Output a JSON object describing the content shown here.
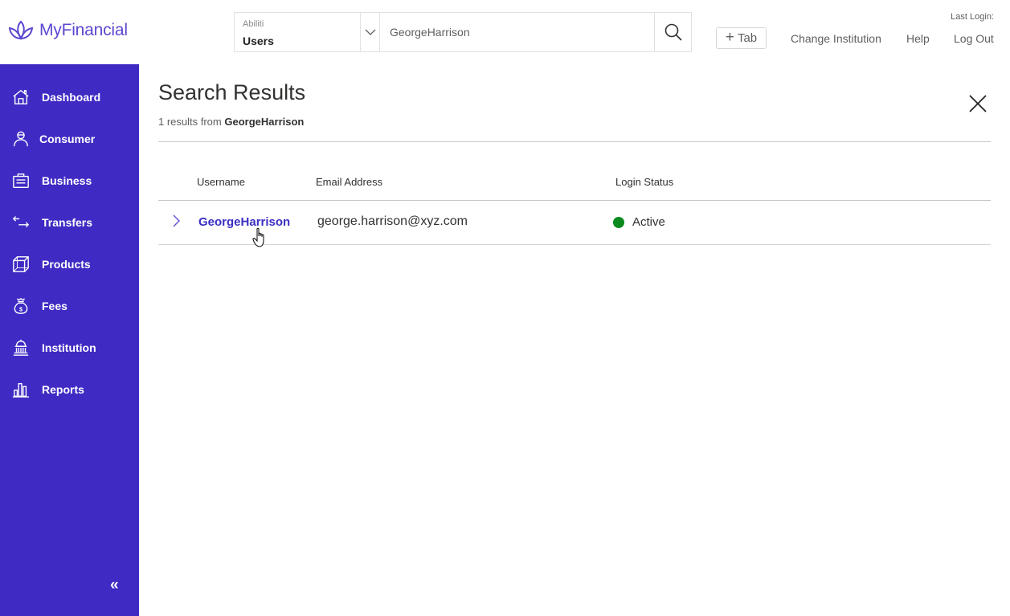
{
  "app": {
    "brand_name": "MyFinancial",
    "brand_color": "#5b48d0",
    "sidebar_color": "#3f2bc4"
  },
  "header": {
    "search": {
      "scope_label": "Abiliti",
      "scope_value": "Users",
      "query": "GeorgeHarrison",
      "search_icon": "search-icon",
      "dropdown_icon": "chevron-down-icon"
    },
    "add_tab_label": "Tab",
    "links": {
      "change_institution": "Change Institution",
      "help": "Help",
      "log_out": "Log Out"
    },
    "last_login_label": "Last Login:"
  },
  "sidebar": {
    "items": [
      {
        "label": "Dashboard",
        "icon": "home-icon"
      },
      {
        "label": "Consumer",
        "icon": "person-icon"
      },
      {
        "label": "Business",
        "icon": "briefcase-icon"
      },
      {
        "label": "Transfers",
        "icon": "transfer-arrows-icon"
      },
      {
        "label": "Products",
        "icon": "cube-icon"
      },
      {
        "label": "Fees",
        "icon": "money-bag-icon"
      },
      {
        "label": "Institution",
        "icon": "bank-building-icon"
      },
      {
        "label": "Reports",
        "icon": "bar-chart-icon"
      }
    ],
    "collapse_label": "«"
  },
  "main": {
    "title": "Search Results",
    "results_count_text": "1 results from",
    "results_query": "GeorgeHarrison",
    "table": {
      "columns": [
        "Username",
        "Email Address",
        "Login Status"
      ],
      "rows": [
        {
          "username": "GeorgeHarrison",
          "email": "george.harrison@xyz.com",
          "status": "Active",
          "status_color": "#0a8a1f"
        }
      ]
    }
  }
}
